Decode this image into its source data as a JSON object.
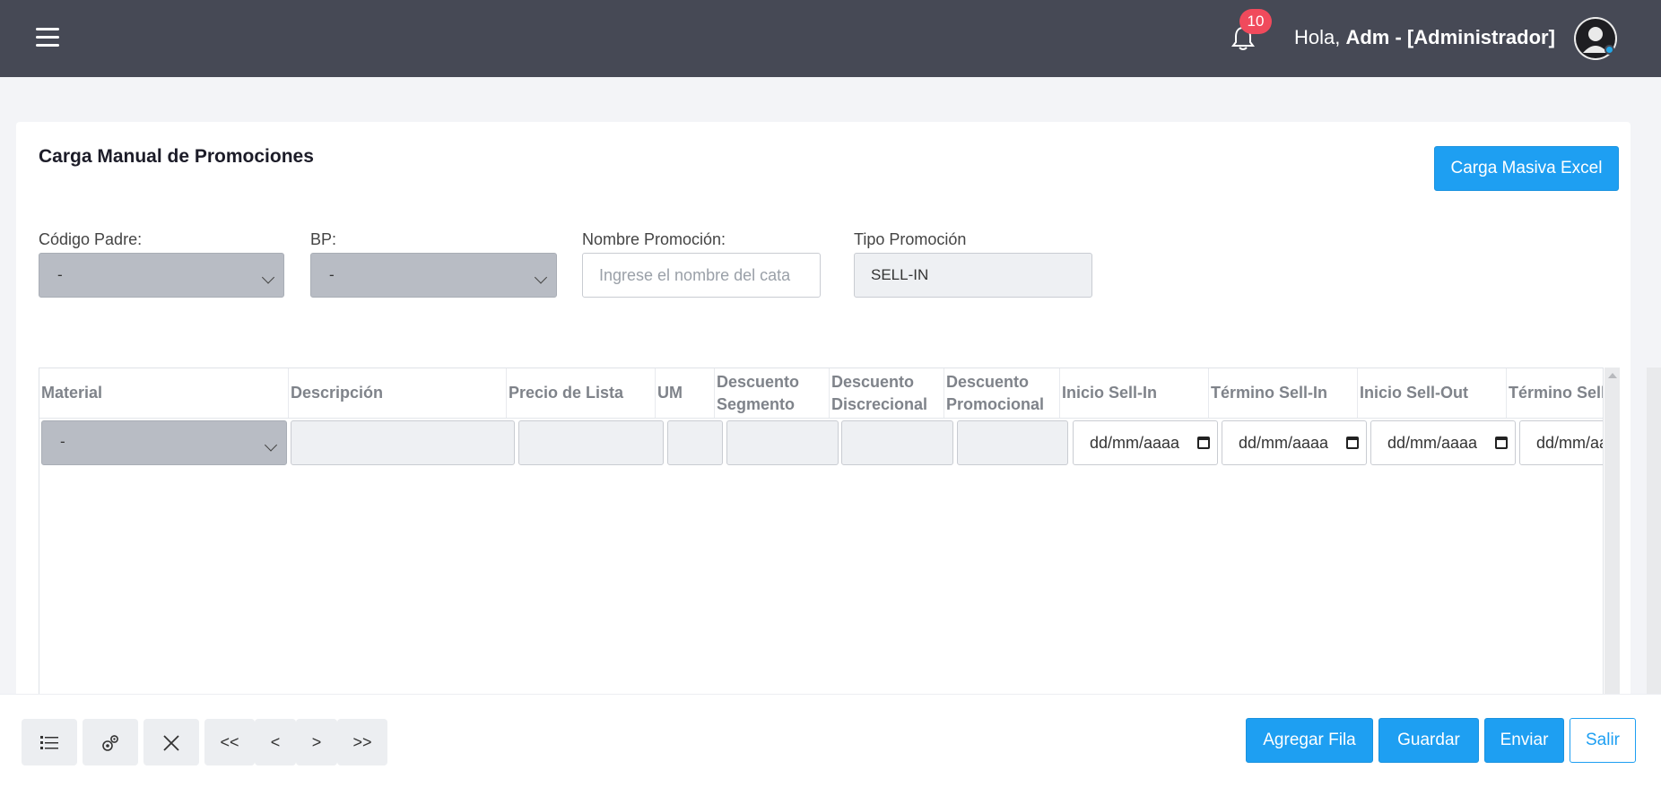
{
  "header": {
    "notifications_count": "10",
    "greeting_prefix": "Hola,",
    "user_name": "Adm - [Administrador]"
  },
  "page": {
    "title": "Carga Manual de Promociones",
    "bulk_upload_label": "Carga Masiva Excel"
  },
  "filters": {
    "codigo_padre": {
      "label": "Código Padre:",
      "value": "-"
    },
    "bp": {
      "label": "BP:",
      "value": "-"
    },
    "nombre_promocion": {
      "label": "Nombre Promoción:",
      "placeholder": "Ingrese el nombre del cata"
    },
    "tipo_promocion": {
      "label": "Tipo Promoción",
      "value": "SELL-IN"
    }
  },
  "table": {
    "columns": [
      "Material",
      "Descripción",
      "Precio de Lista",
      "UM",
      "Descuento Segmento",
      "Descuento Discrecional",
      "Descuento Promocional",
      "Inicio Sell-In",
      "Término Sell-In",
      "Inicio Sell-Out",
      "Término Sell-Out"
    ],
    "row": {
      "material": "-",
      "date_placeholder": "dd/mm/aaaa"
    }
  },
  "toolbar": {
    "prev_all": "<<",
    "prev": "<",
    "next": ">",
    "next_all": ">>",
    "add_row": "Agregar Fila",
    "save": "Guardar",
    "send": "Enviar",
    "exit": "Salir"
  }
}
